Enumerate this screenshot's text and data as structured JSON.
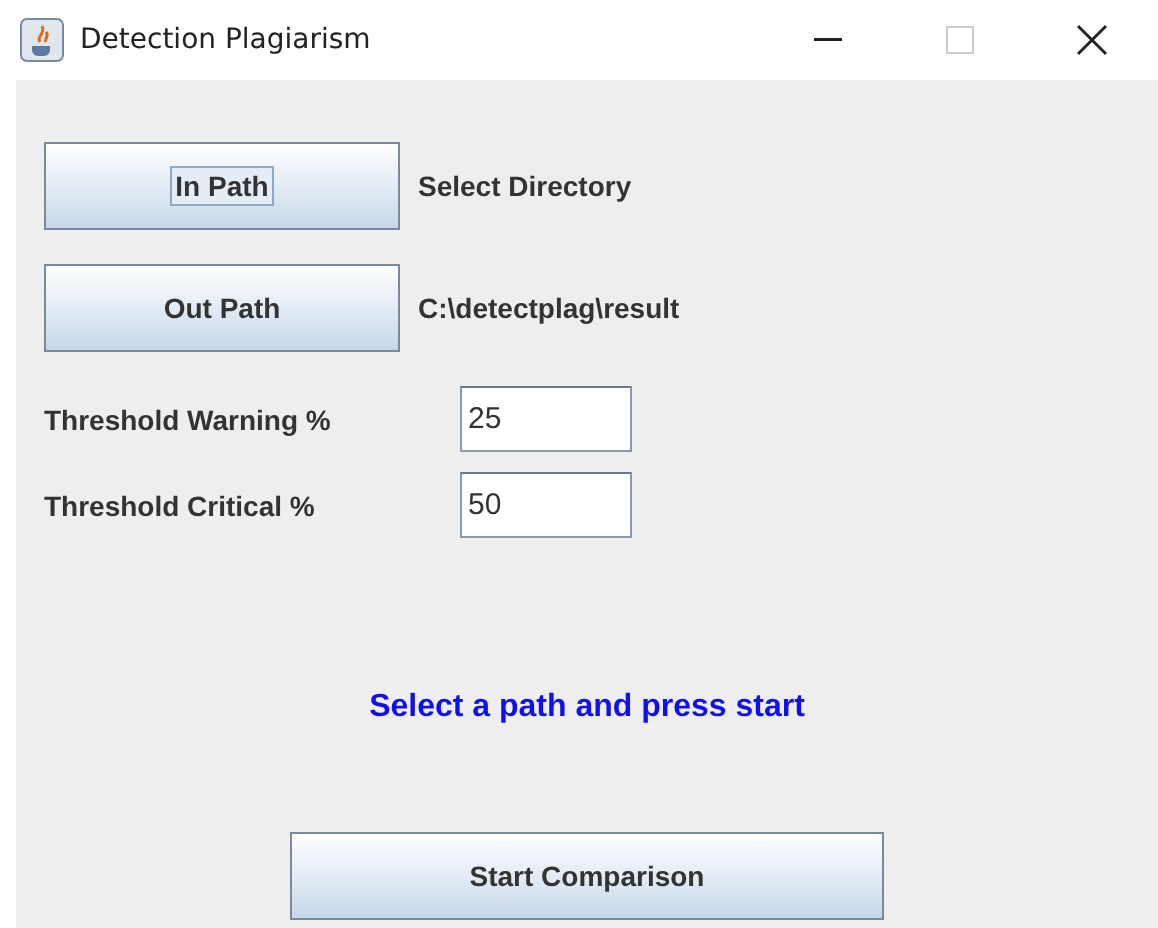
{
  "window": {
    "title": "Detection Plagiarism"
  },
  "paths": [
    {
      "button": "In Path",
      "focused": true,
      "value": "Select Directory"
    },
    {
      "button": "Out Path",
      "focused": false,
      "value": "C:\\detectplag\\result"
    }
  ],
  "thresholds": [
    {
      "label": "Threshold Warning %",
      "value": "25"
    },
    {
      "label": "Threshold Critical %",
      "value": "50"
    }
  ],
  "status": "Select a path and press start",
  "start_button": "Start Comparison"
}
